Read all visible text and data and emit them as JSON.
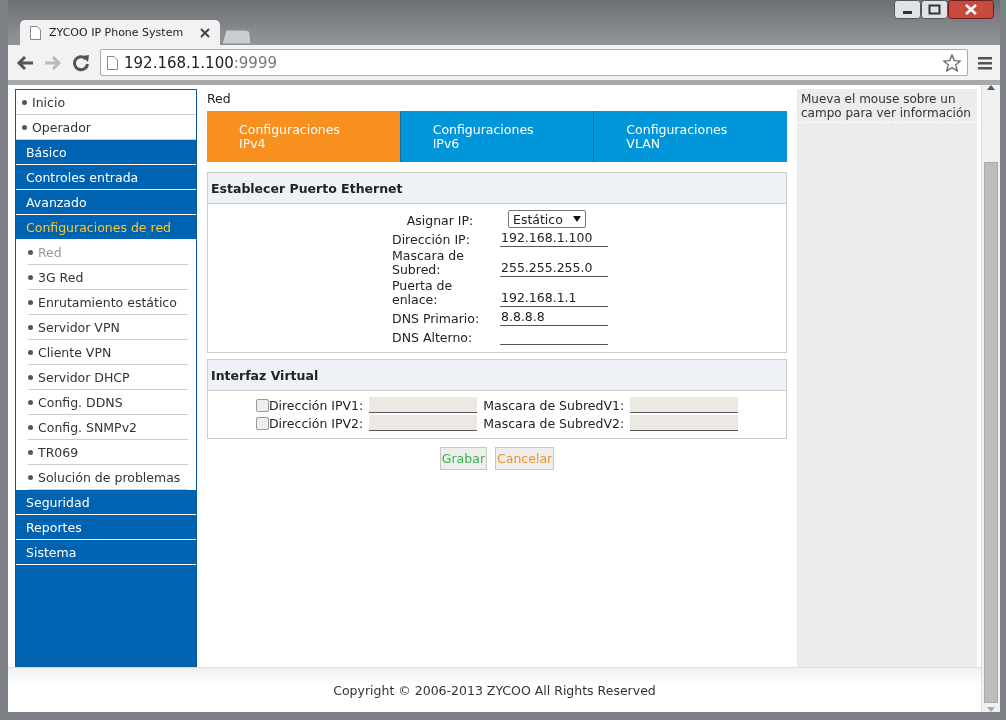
{
  "browser": {
    "tab_title": "ZYCOO IP Phone System",
    "url_host": "192.168.1.100",
    "url_port": ":9999"
  },
  "sidebar": {
    "items": [
      {
        "label": "Inicio",
        "kind": "link",
        "selected": false
      },
      {
        "label": "Operador",
        "kind": "link",
        "selected": false
      },
      {
        "label": "Básico",
        "kind": "section",
        "selected": false
      },
      {
        "label": "Controles entrada",
        "kind": "section",
        "selected": false
      },
      {
        "label": "Avanzado",
        "kind": "section",
        "selected": false
      },
      {
        "label": "Configuraciones de red",
        "kind": "section",
        "selected": true,
        "children": [
          {
            "label": "Red",
            "selected": true
          },
          {
            "label": "3G Red",
            "selected": false
          },
          {
            "label": "Enrutamiento estático",
            "selected": false
          },
          {
            "label": "Servidor VPN",
            "selected": false
          },
          {
            "label": "Cliente VPN",
            "selected": false
          },
          {
            "label": "Servidor DHCP",
            "selected": false
          },
          {
            "label": "Config. DDNS",
            "selected": false
          },
          {
            "label": "Config. SNMPv2",
            "selected": false
          },
          {
            "label": "TR069",
            "selected": false
          },
          {
            "label": "Solución de problemas",
            "selected": false
          }
        ]
      },
      {
        "label": "Seguridad",
        "kind": "section",
        "selected": false
      },
      {
        "label": "Reportes",
        "kind": "section",
        "selected": false
      },
      {
        "label": "Sistema",
        "kind": "section",
        "selected": false
      }
    ]
  },
  "page_title": "Red",
  "tabs": [
    {
      "label": "Configuraciones IPv4",
      "selected": true
    },
    {
      "label": "Configuraciones IPv6",
      "selected": false
    },
    {
      "label": "Configuraciones VLAN",
      "selected": false
    }
  ],
  "ethernet": {
    "title": "Establecer Puerto Ethernet",
    "fields": [
      {
        "kind": "select",
        "label": "Asignar IP:",
        "value": "Estático"
      },
      {
        "kind": "input",
        "label": "Dirección IP:",
        "value": "192.168.1.100"
      },
      {
        "kind": "input",
        "label": "Mascara de Subred:",
        "value": "255.255.255.0"
      },
      {
        "kind": "input",
        "label": "Puerta de enlace:",
        "value": "192.168.1.1"
      },
      {
        "kind": "input",
        "label": "DNS Primario:",
        "value": "8.8.8.8"
      },
      {
        "kind": "input",
        "label": "DNS Alterno:"
      }
    ]
  },
  "virtual": {
    "title": "Interfaz Virtual",
    "rows": [
      {
        "checked": false,
        "disabled": true,
        "ip_label": "Dirección IPV1:",
        "mask_label": "Mascara de SubredV1:"
      },
      {
        "checked": false,
        "disabled": true,
        "ip_label": "Dirección IPV2:",
        "mask_label": "Mascara de SubredV2:"
      }
    ]
  },
  "buttons": [
    {
      "label": "Grabar",
      "kind": "save"
    },
    {
      "label": "Cancelar",
      "kind": "cancel"
    }
  ],
  "help": {
    "text": "Mueva el mouse sobre un campo para ver información"
  },
  "footer": {
    "text": "Copyright © 2006-2013 ZYCOO All Rights Reserved"
  }
}
